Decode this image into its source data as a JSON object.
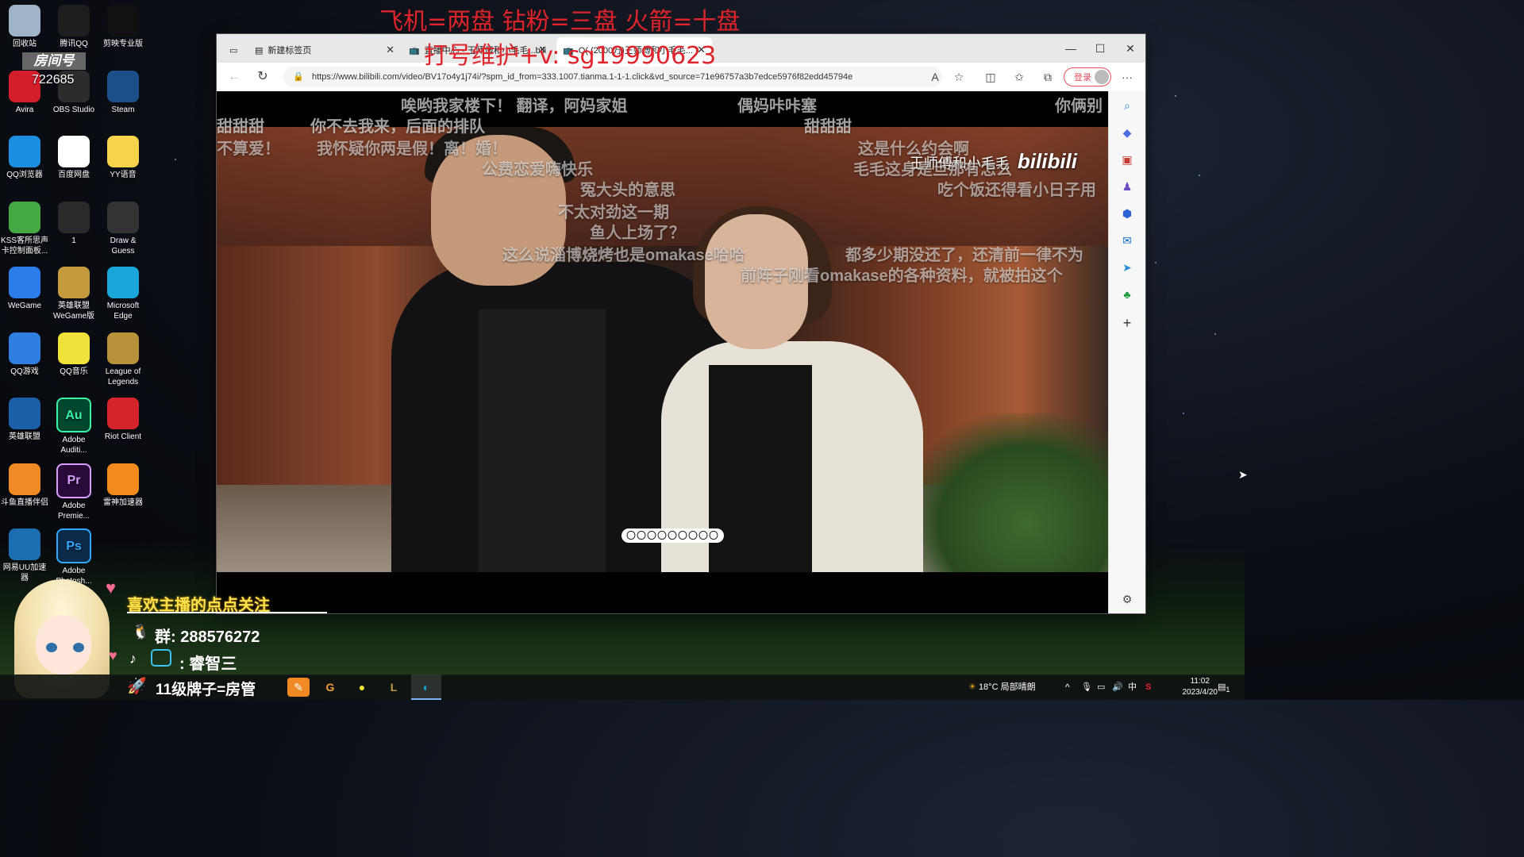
{
  "stream_overlay": {
    "banner": "飞机=两盘  钻粉=三盘  火箭=十盘",
    "contact": "打号维护+v:  sg19990623",
    "room_label": "房间号",
    "room_number": "722685",
    "follow_text": "喜欢主播的点点关注",
    "group_text": "群: 288576272",
    "platform_name": ": 睿智三",
    "badge_text": "11级牌子=房管"
  },
  "desktop_icons": [
    {
      "label": "回收站",
      "icon": "recycle-bin-icon",
      "color": "#9fb4c8"
    },
    {
      "label": "腾讯QQ",
      "icon": "qq-icon",
      "color": "#1e1e1e"
    },
    {
      "label": "剪映专业版",
      "icon": "capcut-icon",
      "color": "#111111"
    },
    {
      "label": "Avira",
      "icon": "avira-icon",
      "color": "#d21d2a"
    },
    {
      "label": "OBS Studio",
      "icon": "obs-icon",
      "color": "#2c2c2c"
    },
    {
      "label": "Steam",
      "icon": "steam-icon",
      "color": "#1b4f8a"
    },
    {
      "label": "QQ浏览器",
      "icon": "qq-browser-icon",
      "color": "#1d8fe0"
    },
    {
      "label": "百度网盘",
      "icon": "baidu-netdisk-icon",
      "color": "#ffffff"
    },
    {
      "label": "YY语音",
      "icon": "yy-icon",
      "color": "#f6d34a"
    },
    {
      "label": "KSS客所思声卡控制面板...",
      "icon": "kss-icon",
      "color": "#44a844"
    },
    {
      "label": "1",
      "icon": "shortcut-icon",
      "color": "#2a2a2a"
    },
    {
      "label": "Draw & Guess",
      "icon": "draw-guess-icon",
      "color": "#333333"
    },
    {
      "label": "WeGame",
      "icon": "wegame-icon",
      "color": "#2b7de9"
    },
    {
      "label": "英雄联盟WeGame版",
      "icon": "lol-wegame-icon",
      "color": "#c59a3c"
    },
    {
      "label": "Microsoft Edge",
      "icon": "edge-icon",
      "color": "#1aa6d9"
    },
    {
      "label": "QQ游戏",
      "icon": "qq-game-icon",
      "color": "#2e7fe0"
    },
    {
      "label": "QQ音乐",
      "icon": "qq-music-icon",
      "color": "#f0e23a"
    },
    {
      "label": "League of Legends",
      "icon": "lol-icon",
      "color": "#b8923a"
    },
    {
      "label": "英雄联盟",
      "icon": "lol-cn-icon",
      "color": "#1a5fa8"
    },
    {
      "label": "Adobe Auditi...",
      "icon": "audition-icon",
      "color": "#00472f"
    },
    {
      "label": "Riot Client",
      "icon": "riot-icon",
      "color": "#d3252b"
    },
    {
      "label": "斗鱼直播伴侣",
      "icon": "douyu-icon",
      "color": "#f08a24"
    },
    {
      "label": "Adobe Premie...",
      "icon": "premiere-icon",
      "color": "#2a0a3a"
    },
    {
      "label": "雷神加速器",
      "icon": "leishen-icon",
      "color": "#f28a1e"
    },
    {
      "label": "网易UU加速器",
      "icon": "uu-icon",
      "color": "#1b6fb0"
    },
    {
      "label": "Adobe Photosh...",
      "icon": "photoshop-icon",
      "color": "#0a2a4a"
    }
  ],
  "icon_glyphs": {
    "Au": "Au",
    "Pr": "Pr",
    "Ps": "Ps"
  },
  "browser": {
    "tabs": [
      {
        "label": "新建标签页",
        "active": false
      },
      {
        "label": "直播中心 - 王师傅和小毛毛...bili",
        "active": false
      },
      {
        "label": "Q(  (2000万)王师傅和小毛毛...",
        "active": true
      }
    ],
    "url": "https://www.bilibili.com/video/BV17o4y1j74i/?spm_id_from=333.1007.tianma.1-1-1.click&vd_source=71e96757a3b7edce5976f82edd45794e",
    "login_label": "登录",
    "window_controls": {
      "minimize": "—",
      "maximize": "☐",
      "close": "✕"
    }
  },
  "video": {
    "watermark": "王师傅和小毛毛",
    "watermark_brand": "bilibili",
    "subtitle": "〇〇〇〇〇〇〇〇〇",
    "danmaku": [
      "唉哟我家楼下！ 翻译，阿妈家姐",
      "偶妈咔咔塞",
      "你俩别",
      "甜甜甜",
      "你不去我来，后面的排队",
      "甜甜甜",
      "不算爱！",
      "我怀疑你两是假！离！婚！",
      "这是什么约会啊",
      "毛毛这身是旦那有怎么",
      "公费恋爱嗨快乐",
      "吃个饭还得看小日子用",
      "冤大头的意思",
      "不太对劲这一期",
      "鱼人上场了？",
      "这么说淄博烧烤也是omakase哈哈",
      "都多少期没还了，还清前一律不为",
      "前阵子刚看omakase的各种资料，就被拍这个"
    ]
  },
  "taskbar": {
    "weather": "18°C  局部晴朗",
    "ime": "中",
    "time": "11:02",
    "date": "2023/4/20",
    "notification_count": "1"
  }
}
